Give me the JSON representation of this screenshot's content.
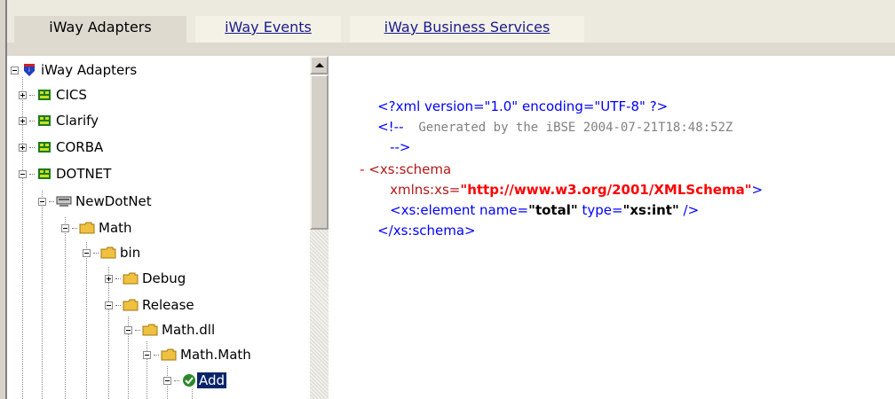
{
  "tabs": [
    {
      "label": "iWay Adapters",
      "active": true
    },
    {
      "label": "iWay Events",
      "active": false
    },
    {
      "label": "iWay Business Services",
      "active": false
    }
  ],
  "tree": {
    "root": "iWay Adapters",
    "items": [
      {
        "label": "CICS",
        "expander": "plus",
        "icon": "adapter-icon"
      },
      {
        "label": "Clarify",
        "expander": "plus",
        "icon": "adapter-icon"
      },
      {
        "label": "CORBA",
        "expander": "plus",
        "icon": "adapter-icon"
      },
      {
        "label": "DOTNET",
        "expander": "minus",
        "icon": "adapter-icon"
      },
      {
        "label": "NewDotNet",
        "expander": "minus",
        "icon": "server-icon"
      },
      {
        "label": "Math",
        "expander": "minus",
        "icon": "folder-icon"
      },
      {
        "label": "bin",
        "expander": "minus",
        "icon": "folder-icon"
      },
      {
        "label": "Debug",
        "expander": "plus",
        "icon": "folder-icon"
      },
      {
        "label": "Release",
        "expander": "minus",
        "icon": "folder-icon"
      },
      {
        "label": "Math.dll",
        "expander": "minus",
        "icon": "folder-icon"
      },
      {
        "label": "Math.Math",
        "expander": "minus",
        "icon": "folder-icon"
      },
      {
        "label": "Add",
        "expander": "minus",
        "icon": "check-icon",
        "selected": true
      }
    ]
  },
  "xml": {
    "decl": "<?xml version=\"1.0\" encoding=\"UTF-8\" ?>",
    "comment_open": "<!--",
    "comment_text": "  Generated by the iBSE 2004-07-21T18:48:52Z",
    "comment_close": "-->",
    "collapse": "-",
    "schema_open": "<xs:schema",
    "xmlns_attr": "xmlns:xs=",
    "xmlns_value": "\"http://www.w3.org/2001/XMLSchema\"",
    "xmlns_close": ">",
    "element_open": "<xs:element name=",
    "element_name": "\"total\"",
    "element_type_attr": " type=",
    "element_type": "\"xs:int\"",
    "element_close": " />",
    "schema_close": "</xs:schema>"
  }
}
